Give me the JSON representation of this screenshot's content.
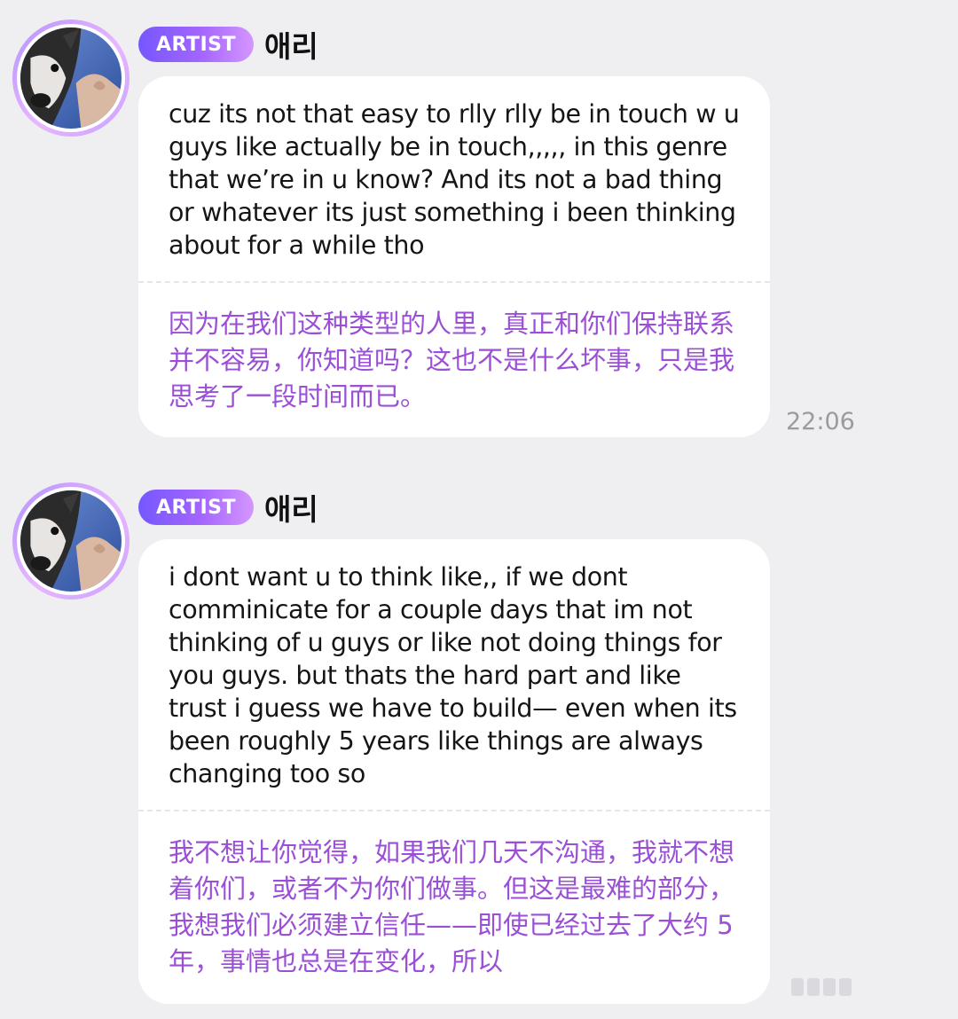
{
  "messages": [
    {
      "badge": "ARTIST",
      "name": "애리",
      "text_en": "cuz its not that easy to rlly rlly be in touch w u guys like actually be in touch,,,,, in this genre that we’re in u know? And its not a bad thing or whatever its just something i been thinking about for a while tho",
      "text_zh": "因为在我们这种类型的人里，真正和你们保持联系并不容易，你知道吗？这也不是什么坏事，只是我思考了一段时间而已。",
      "time": "22:06"
    },
    {
      "badge": "ARTIST",
      "name": "애리",
      "text_en": "i dont want u to think like,, if we dont comminicate for a couple days that im not thinking of u guys or like not doing things for you guys. but thats the hard part and like trust i guess we have to build— even when its been roughly 5 years like things are always changing too so",
      "text_zh": "我不想让你觉得，如果我们几天不沟通，我就不想着你们，或者不为你们做事。但这是最难的部分，我想我们必须建立信任——即使已经过去了大约 5 年，事情也总是在变化，所以"
    }
  ],
  "colors": {
    "background": "#efeff1",
    "bubble": "#ffffff",
    "translation_text": "#9a4fd6",
    "badge_gradient_start": "#7557ff",
    "badge_gradient_end": "#d596ff"
  },
  "icons": {
    "avatar": "dog-photo-avatar"
  }
}
